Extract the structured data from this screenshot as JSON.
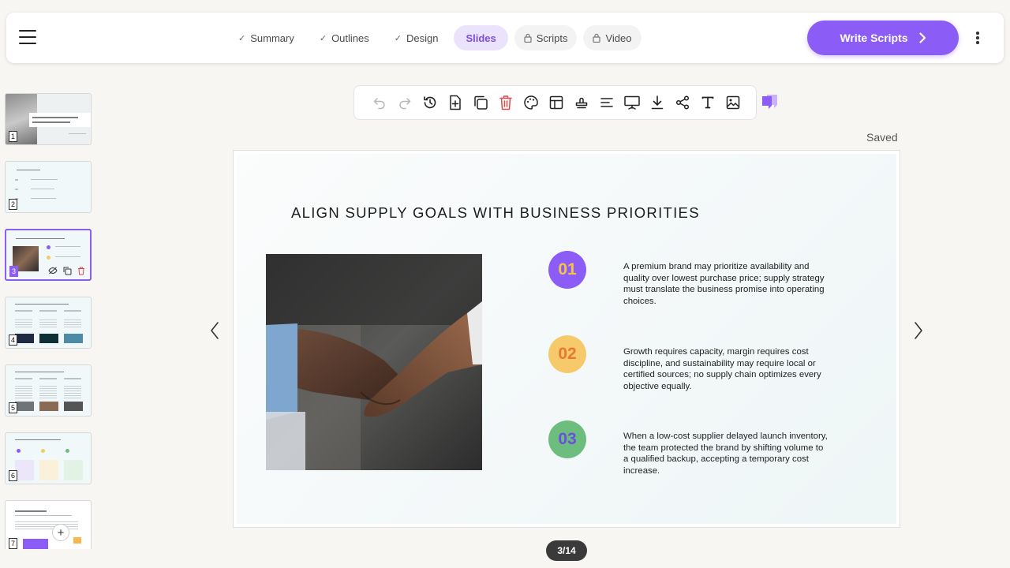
{
  "header": {
    "steps": [
      {
        "label": "Summary",
        "state": "done"
      },
      {
        "label": "Outlines",
        "state": "done"
      },
      {
        "label": "Design",
        "state": "done"
      },
      {
        "label": "Slides",
        "state": "active"
      },
      {
        "label": "Scripts",
        "state": "locked"
      },
      {
        "label": "Video",
        "state": "locked"
      }
    ],
    "primary_button": "Write Scripts"
  },
  "toolbar": {
    "icons": [
      "undo-icon",
      "redo-icon",
      "history-icon",
      "add-page-icon",
      "duplicate-icon",
      "delete-icon",
      "palette-icon",
      "layout-icon",
      "stamp-icon",
      "align-icon",
      "present-icon",
      "download-icon",
      "share-icon",
      "text-icon",
      "image-icon"
    ],
    "status": "Saved"
  },
  "thumbnails": {
    "numbers": [
      "1",
      "2",
      "3",
      "4",
      "5",
      "6",
      "7"
    ],
    "selected": "3",
    "thumb1_title": "Supply Chain Management Strategies and Practices"
  },
  "slide": {
    "title": "ALIGN SUPPLY GOALS WITH BUSINESS PRIORITIES",
    "items": [
      {
        "num": "01",
        "text": "A premium brand may prioritize availability and quality over lowest purchase price; supply strategy must translate the business promise into operating choices.",
        "badge_bg": "#8b5cf6",
        "num_color": "#f6c445"
      },
      {
        "num": "02",
        "text": "Growth requires capacity, margin requires cost discipline, and sustainability may require local or certified sources; no supply chain optimizes every objective equally.",
        "badge_bg": "#f6c96a",
        "num_color": "#e8792f"
      },
      {
        "num": "03",
        "text": "When a low-cost supplier delayed launch inventory, the team protected the brand by shifting volume to a qualified backup, accepting a temporary cost increase.",
        "badge_bg": "#6dbd7e",
        "num_color": "#6a4fe0"
      }
    ]
  },
  "pager": {
    "label": "3/14"
  },
  "colors": {
    "accent": "#8b5cf6",
    "delete": "#e04848"
  }
}
